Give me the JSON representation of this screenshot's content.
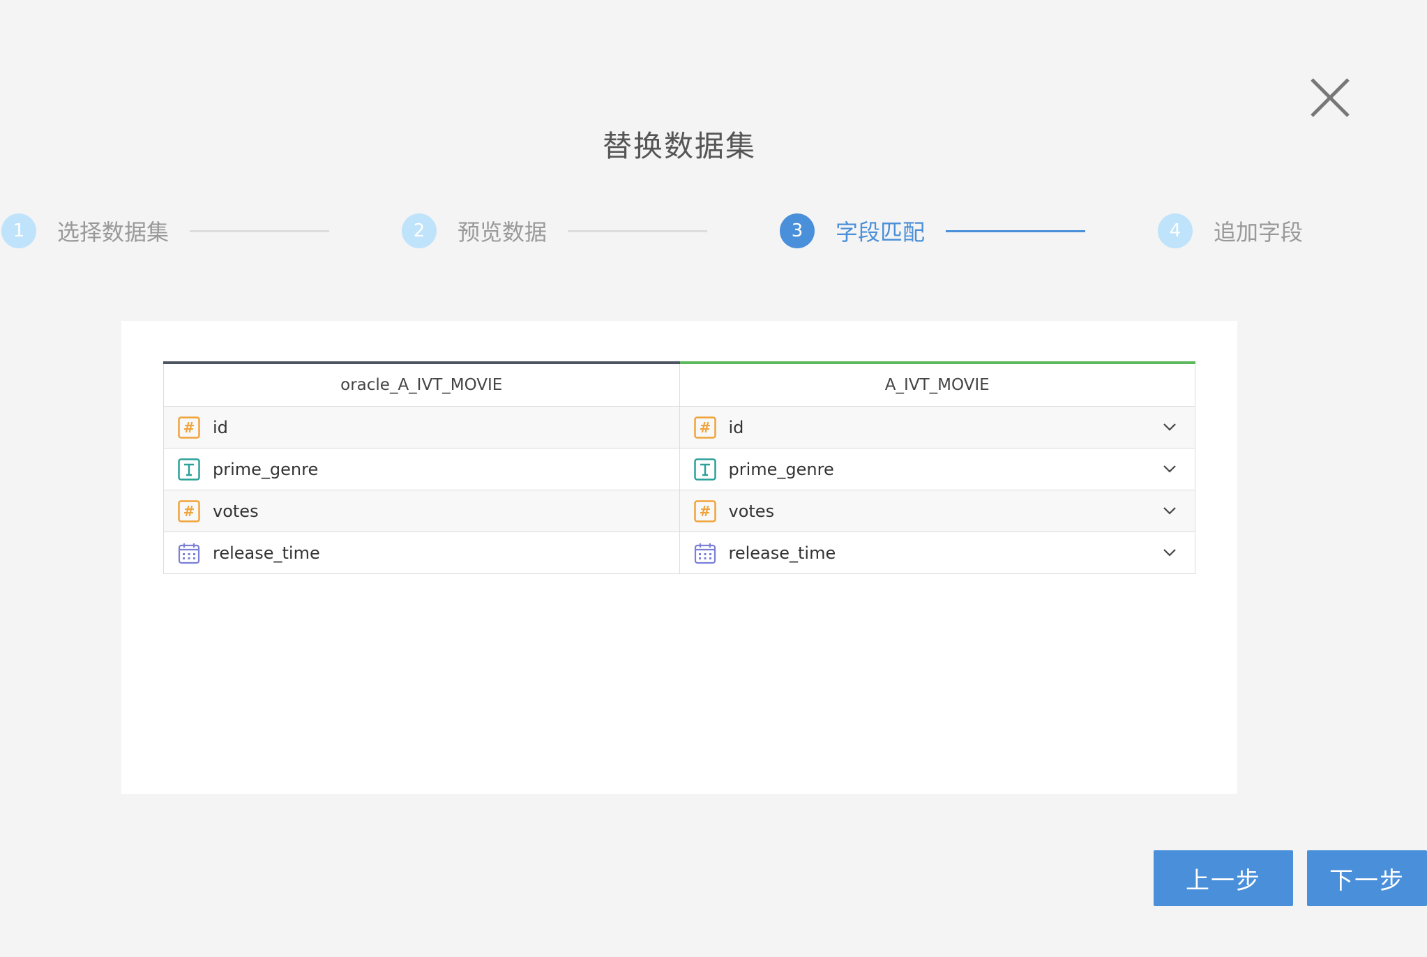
{
  "dialog": {
    "title": "替换数据集"
  },
  "steps": [
    {
      "number": "1",
      "label": "选择数据集",
      "active": false
    },
    {
      "number": "2",
      "label": "预览数据",
      "active": false
    },
    {
      "number": "3",
      "label": "字段匹配",
      "active": true
    },
    {
      "number": "4",
      "label": "追加字段",
      "active": false
    }
  ],
  "mapping": {
    "source_header": "oracle_A_IVT_MOVIE",
    "target_header": "A_IVT_MOVIE",
    "rows": [
      {
        "type": "number-icon",
        "source": "id",
        "target": "id"
      },
      {
        "type": "text-icon",
        "source": "prime_genre",
        "target": "prime_genre"
      },
      {
        "type": "number-icon",
        "source": "votes",
        "target": "votes"
      },
      {
        "type": "date-icon",
        "source": "release_time",
        "target": "release_time"
      }
    ]
  },
  "footer": {
    "prev_label": "上一步",
    "next_label": "下一步"
  },
  "colors": {
    "accent": "#4a8fd9",
    "step_inactive": "#bfe3fb",
    "number_icon": "#f0a33a",
    "text_icon": "#2aa198",
    "date_icon": "#7b7fd6",
    "source_header_bar": "#4d5360",
    "target_header_bar": "#5cb85c"
  }
}
